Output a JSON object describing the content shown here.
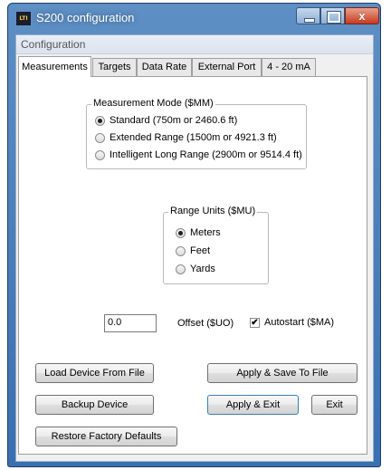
{
  "window": {
    "title": "S200 configuration",
    "app_icon_text": "LTI",
    "close_glyph": "x"
  },
  "menu": {
    "items": [
      "Configuration"
    ]
  },
  "tabs": [
    {
      "label": "Measurements",
      "active": true
    },
    {
      "label": "Targets"
    },
    {
      "label": "Data Rate"
    },
    {
      "label": "External Port"
    },
    {
      "label": "4 - 20 mA"
    }
  ],
  "measurement_mode": {
    "title": "Measurement Mode ($MM)",
    "options": [
      {
        "label": "Standard (750m or 2460.6 ft)",
        "selected": true
      },
      {
        "label": "Extended Range (1500m or 4921.3 ft)",
        "selected": false
      },
      {
        "label": "Intelligent Long Range (2900m or 9514.4 ft)",
        "selected": false
      }
    ]
  },
  "range_units": {
    "title": "Range Units ($MU)",
    "options": [
      {
        "label": "Meters",
        "selected": true
      },
      {
        "label": "Feet",
        "selected": false
      },
      {
        "label": "Yards",
        "selected": false
      }
    ]
  },
  "offset": {
    "value": "0.0",
    "label": "Offset ($UO)"
  },
  "autostart": {
    "label": "Autostart ($MA)",
    "checked": true,
    "check_glyph": "✔"
  },
  "buttons": {
    "load": "Load Device From File",
    "apply_save": "Apply & Save To File",
    "backup": "Backup Device",
    "apply_exit": "Apply & Exit",
    "exit": "Exit",
    "restore": "Restore Factory Defaults"
  }
}
